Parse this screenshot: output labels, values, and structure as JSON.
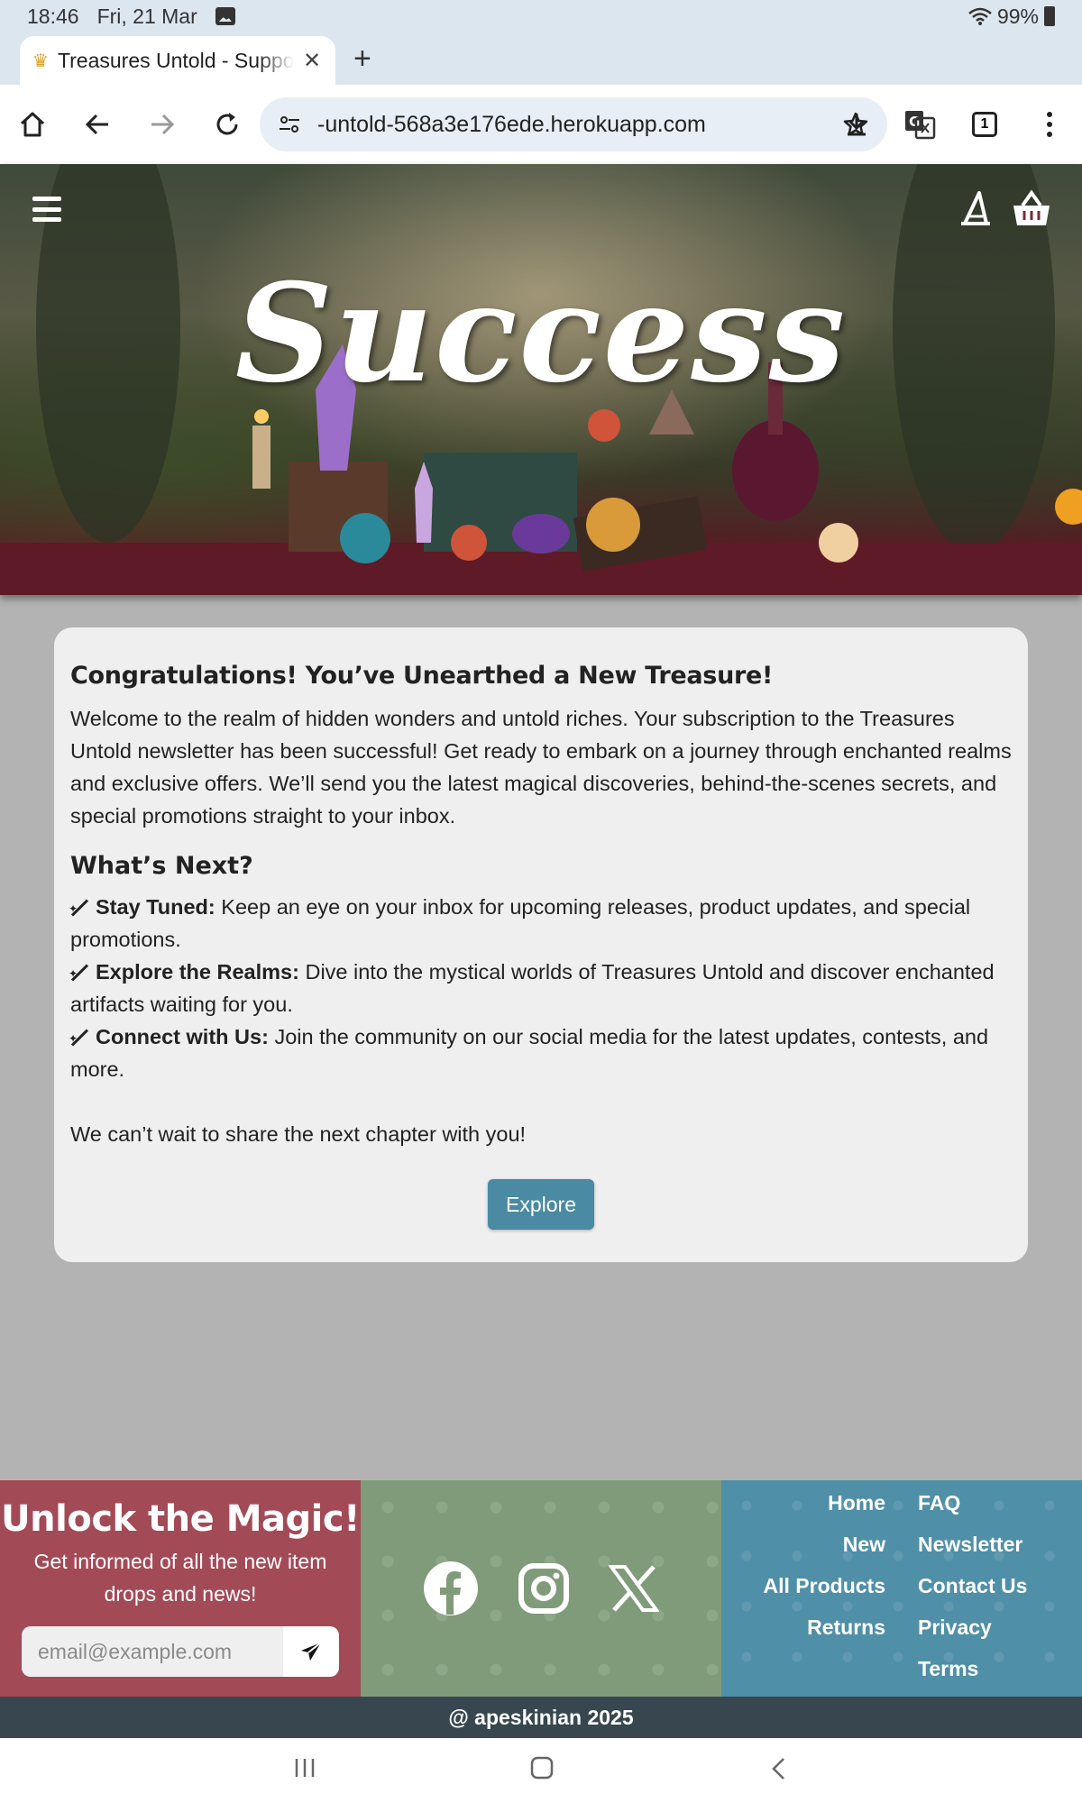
{
  "status_bar": {
    "time": "18:46",
    "date": "Fri, 21 Mar",
    "battery": "99%"
  },
  "browser": {
    "tab_title": "Treasures Untold - Support",
    "url": "-untold-568a3e176ede.herokuapp.com",
    "tab_count": "1"
  },
  "hero": {
    "title": "Success"
  },
  "card": {
    "heading": "Congratulations! You’ve Unearthed a New Treasure!",
    "intro": "Welcome to the realm of hidden wonders and untold riches. Your subscription to the Treasures Untold newsletter has been successful! Get ready to embark on a journey through enchanted realms and exclusive offers. We’ll send you the latest magical discoveries, behind-the-scenes secrets, and special promotions straight to your inbox.",
    "next_heading": "What’s Next?",
    "items": [
      {
        "title": "Stay Tuned:",
        "text": " Keep an eye on your inbox for upcoming releases, product updates, and special promotions."
      },
      {
        "title": "Explore the Realms:",
        "text": " Dive into the mystical worlds of Treasures Untold and discover enchanted artifacts waiting for you."
      },
      {
        "title": "Connect with Us:",
        "text": " Join the community on our social media for the latest updates, contests, and more."
      }
    ],
    "closing": "We can’t wait to share the next chapter with you!",
    "button": "Explore"
  },
  "footer": {
    "newsletter_title": "Unlock the Magic!",
    "newsletter_text_1": "Get informed of all the new item",
    "newsletter_text_2": "drops and news!",
    "email_placeholder": "email@example.com",
    "links": {
      "home": "Home",
      "faq": "FAQ",
      "new": "New",
      "newsletter": "Newsletter",
      "all_products": "All Products",
      "contact": "Contact Us",
      "returns": "Returns",
      "privacy": "Privacy",
      "terms": "Terms"
    },
    "copyright": "@ apeskinian 2025"
  }
}
